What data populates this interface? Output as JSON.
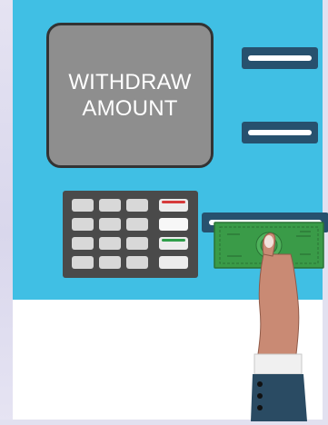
{
  "screen": {
    "line1": "WITHDRAW",
    "line2": "AMOUNT"
  },
  "colors": {
    "atm_body": "#40bfe4",
    "screen": "#8e8e8e",
    "slot": "#27516e",
    "keypad": "#4a4a4a",
    "cash": "#3a9b48",
    "cancel_key": "#d63a3a",
    "enter_key": "#2f9e4a"
  },
  "icons": [
    "card-slot-icon",
    "receipt-slot-icon",
    "keypad-icon",
    "cash-dispenser-icon",
    "banknote-icon",
    "hand-icon"
  ]
}
